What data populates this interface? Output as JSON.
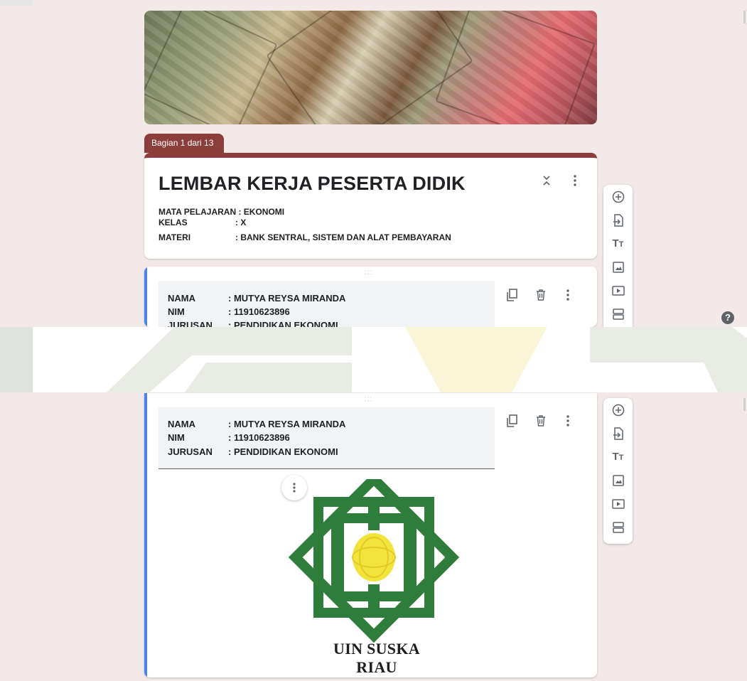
{
  "section_tab": {
    "label": "Bagian 1 dari 13"
  },
  "colors": {
    "theme": "#8c3f3a",
    "accent_bar": "#4285f4",
    "background": "#f3e9e8",
    "logo_green": "#2e7d3a",
    "logo_yellow": "#f2e33a"
  },
  "title_card": {
    "title": "LEMBAR KERJA PESERTA DIDIK",
    "description": [
      {
        "label": "MATA PELAJARAN",
        "value": ": EKONOMI"
      },
      {
        "label": "KELAS",
        "value": ": X"
      },
      {
        "label": "MATERI",
        "value": ": BANK SENTRAL, SISTEM DAN ALAT PEMBAYARAN"
      }
    ],
    "icons": [
      "collapse-icon",
      "more-vert-icon"
    ]
  },
  "student_block": [
    {
      "label": "NAMA",
      "value": ": MUTYA REYSA MIRANDA"
    },
    {
      "label": "NIM",
      "value": ": 11910623896"
    },
    {
      "label": "JURUSAN",
      "value": ": PENDIDIKAN EKONOMI"
    }
  ],
  "question_actions": [
    "duplicate-icon",
    "delete-icon",
    "more-vert-icon"
  ],
  "side_toolbar": [
    "add-question-icon",
    "import-questions-icon",
    "add-title-icon",
    "add-image-icon",
    "add-video-icon",
    "add-section-icon"
  ],
  "help": {
    "label": "?"
  },
  "logo": {
    "caption": "UIN SUSKA RIAU"
  },
  "drag_handle": ":::"
}
